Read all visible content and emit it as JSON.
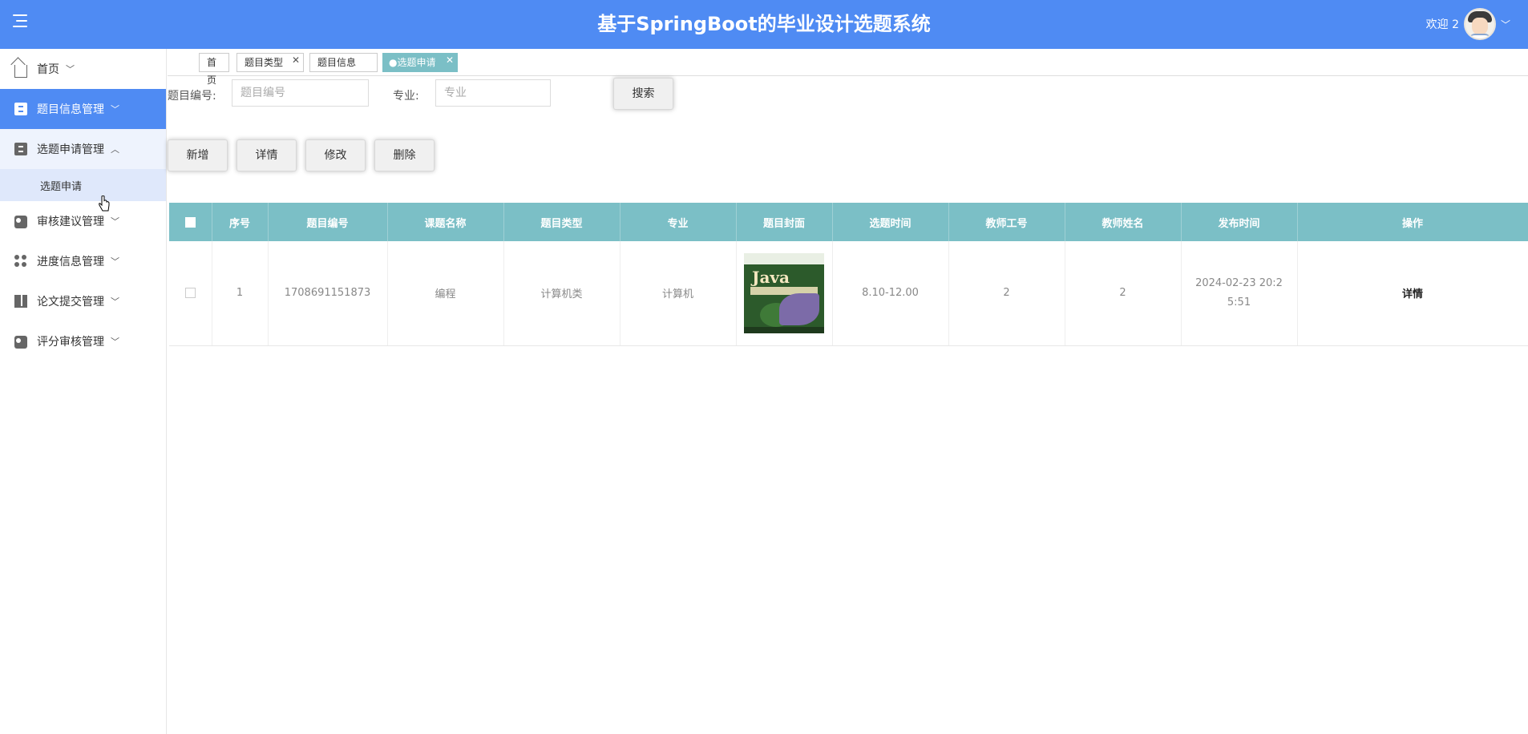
{
  "header": {
    "title": "基于SpringBoot的毕业设计选题系统",
    "welcome": "欢迎 2",
    "menu_icon": "hamburger-menu-icon",
    "avatar_icon": "avatar-icon",
    "dropdown_icon": "chevron-down-icon"
  },
  "sidebar": {
    "items": [
      {
        "label": "首页",
        "icon": "home-icon",
        "arrow": "﹀"
      },
      {
        "label": "题目信息管理",
        "icon": "document-box-icon",
        "arrow": "﹀"
      },
      {
        "label": "选题申请管理",
        "icon": "document-box-icon",
        "arrow": "︿"
      },
      {
        "label": "审核建议管理",
        "icon": "toggle-icon",
        "arrow": "﹀"
      },
      {
        "label": "进度信息管理",
        "icon": "grid-dots-icon",
        "arrow": "﹀"
      },
      {
        "label": "论文提交管理",
        "icon": "book-icon",
        "arrow": "﹀"
      },
      {
        "label": "评分审核管理",
        "icon": "toggle-icon",
        "arrow": "﹀"
      }
    ],
    "sub_item": "选题申请"
  },
  "tabs": [
    {
      "label": "首页"
    },
    {
      "label": "题目类型",
      "close": "✕"
    },
    {
      "label": "题目信息"
    },
    {
      "label": "●选题申请",
      "close": "✕"
    }
  ],
  "search": {
    "label_id": "题目编号:",
    "placeholder_id": "题目编号",
    "label_major": "专业:",
    "placeholder_major": "专业",
    "button": "搜索"
  },
  "actions": {
    "add": "新增",
    "detail": "详情",
    "edit": "修改",
    "delete": "删除"
  },
  "table": {
    "columns": [
      "序号",
      "题目编号",
      "课题名称",
      "题目类型",
      "专业",
      "题目封面",
      "选题时间",
      "教师工号",
      "教师姓名",
      "发布时间",
      "操作"
    ],
    "rows": [
      {
        "index": "1",
        "topic_no": "1708691151873",
        "topic_name": "编程",
        "topic_type": "计算机类",
        "major": "计算机",
        "cover_title": "Java",
        "select_time": "8.10-12.00",
        "teacher_no": "2",
        "teacher_name": "2",
        "publish_time": "2024-02-23 20:25:51",
        "operation": "详情"
      }
    ]
  },
  "colors": {
    "header": "#4f8bf3",
    "table_header": "#7bbfc6",
    "active_tab": "#7bbfc6"
  }
}
